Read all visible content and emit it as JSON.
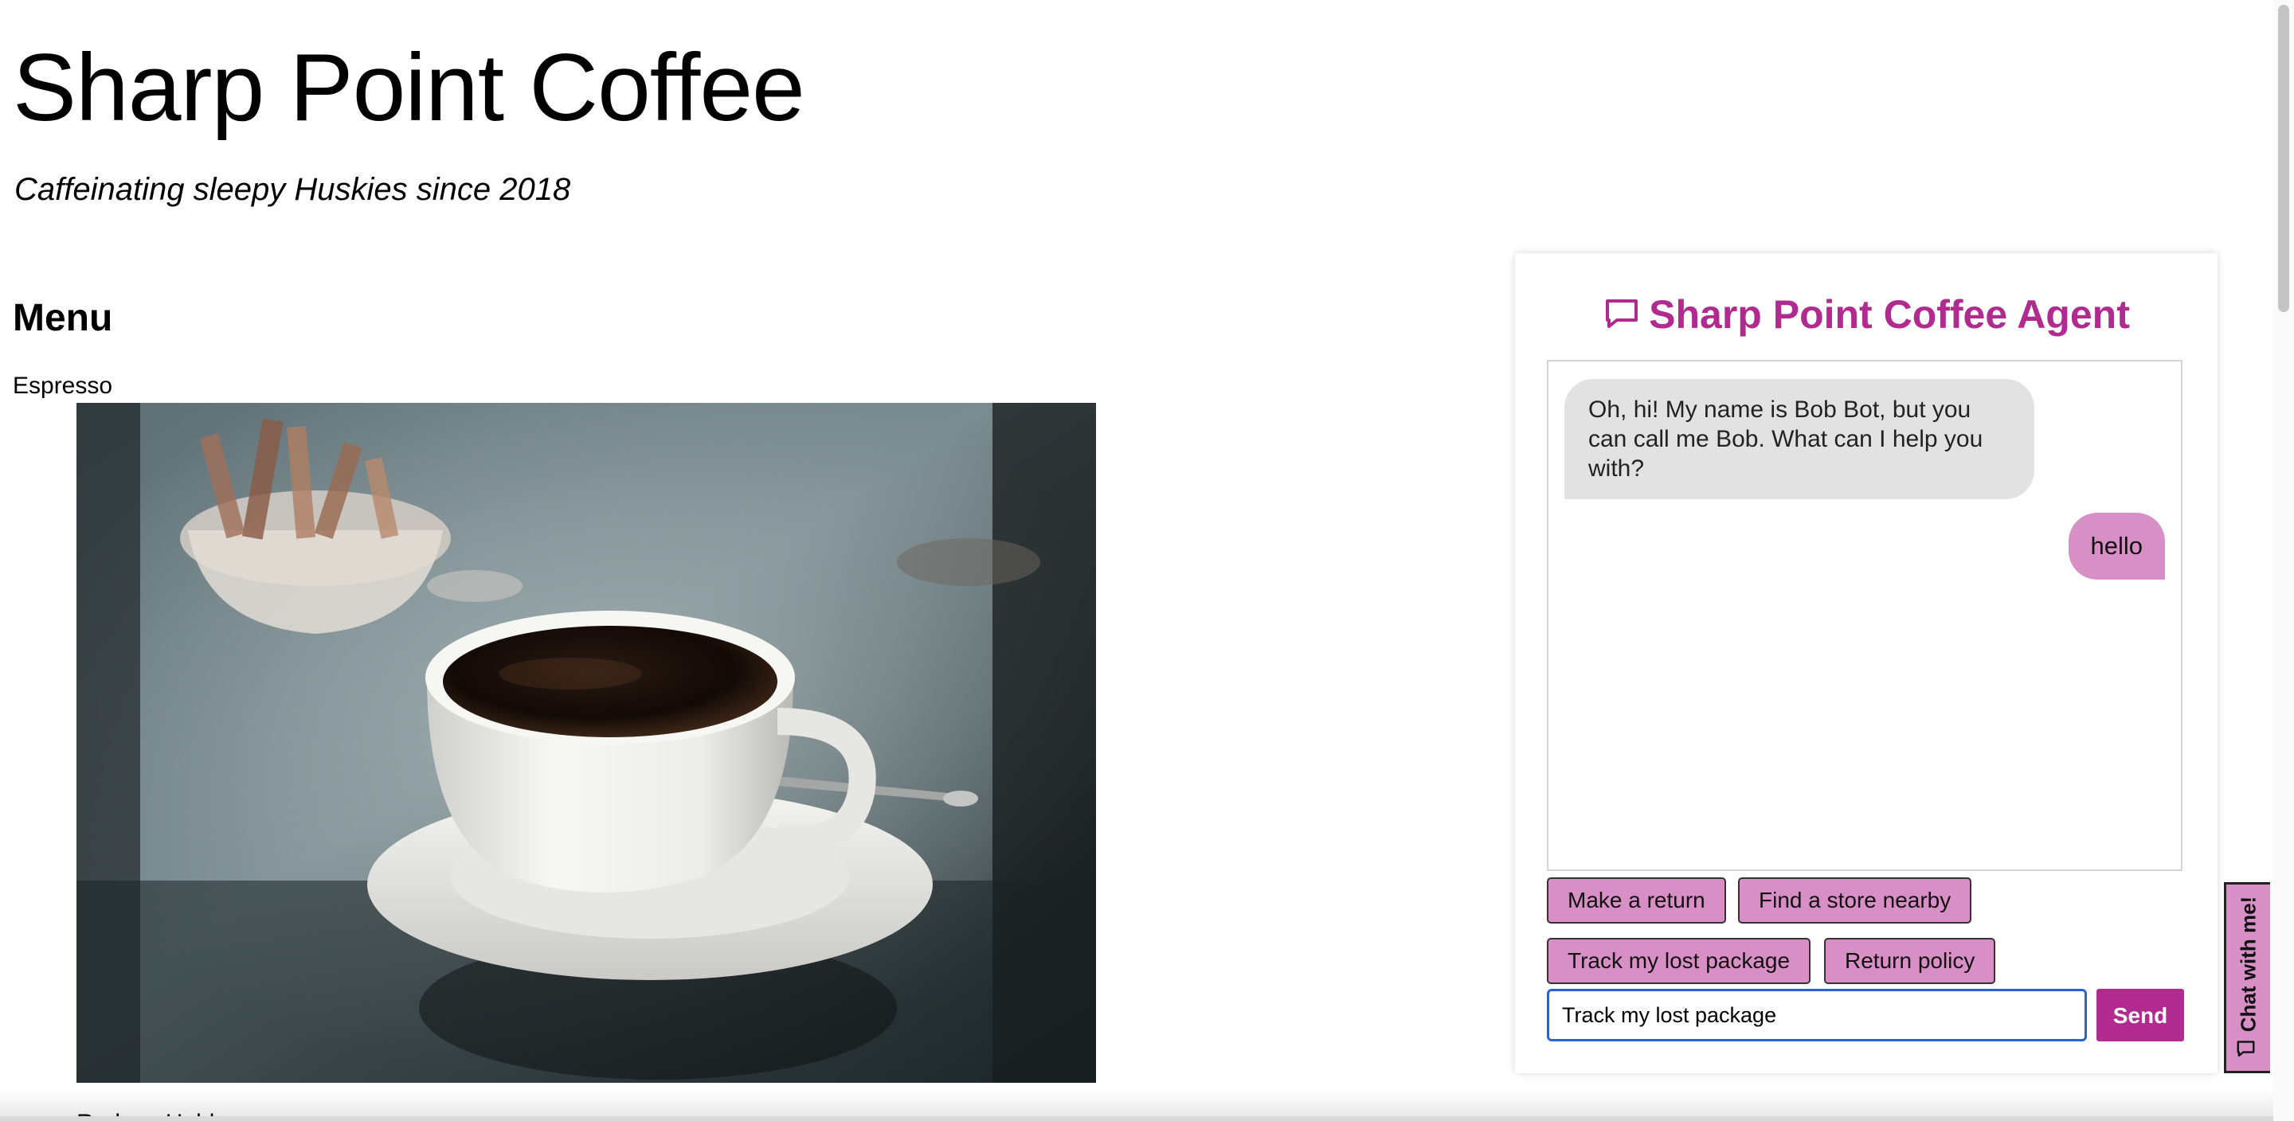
{
  "site": {
    "title": "Sharp Point Coffee",
    "tagline": "Caffeinating sleepy Huskies since 2018"
  },
  "menu": {
    "heading": "Menu",
    "items": [
      {
        "name": "Espresso",
        "image_icon": "espresso-cup-photo"
      },
      {
        "name": "Redeye Hubbs"
      }
    ]
  },
  "chat": {
    "title": "Sharp Point Coffee Agent",
    "title_icon": "speech-bubble-icon",
    "accent_color": "#b12a8f",
    "bubble_color": "#d88fc5",
    "messages": [
      {
        "sender": "bot",
        "text": "Oh, hi! My name is Bob Bot, but you can call me Bob. What can I help you with?"
      },
      {
        "sender": "user",
        "text": "hello"
      }
    ],
    "quick_replies": [
      "Make a return",
      "Find a store nearby",
      "Track my lost package",
      "Return policy"
    ],
    "input_value": "Track my lost package",
    "send_label": "Send",
    "tab_label": "Chat with me!"
  }
}
